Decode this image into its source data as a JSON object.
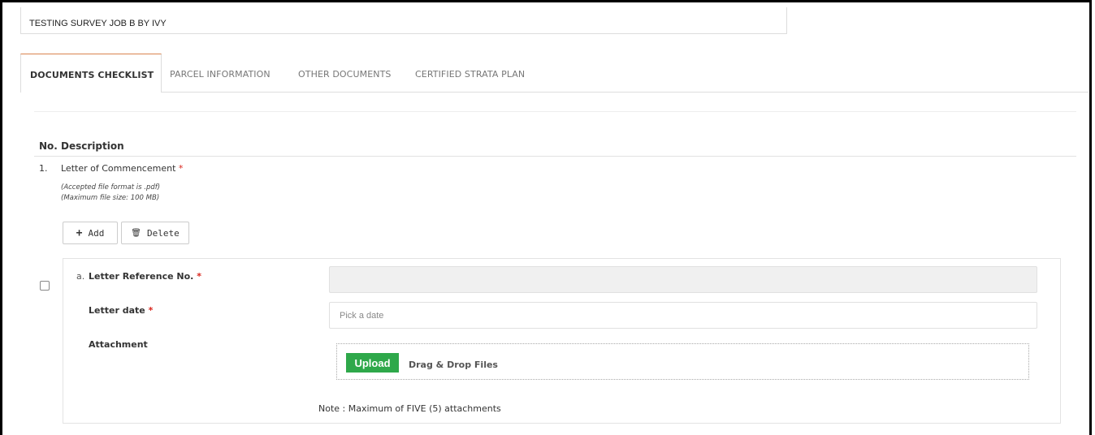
{
  "job": {
    "title": "TESTING SURVEY JOB B BY IVY"
  },
  "tabs": [
    {
      "label": "DOCUMENTS CHECKLIST",
      "active": true
    },
    {
      "label": "PARCEL INFORMATION"
    },
    {
      "label": "OTHER DOCUMENTS"
    },
    {
      "label": "CERTIFIED STRATA PLAN"
    }
  ],
  "table": {
    "col_no": "No.",
    "col_desc": "Description"
  },
  "item": {
    "number": "1.",
    "title": "Letter of Commencement",
    "required_mark": "*",
    "format_note": "(Accepted file format is .pdf)",
    "size_note": "(Maximum file size: 100 MB)"
  },
  "buttons": {
    "add": "Add",
    "delete": "Delete",
    "add_icon": "+",
    "delete_icon": "🗑"
  },
  "entry": {
    "letter": "a.",
    "ref_label": "Letter Reference No.",
    "ref_value": "",
    "date_label": "Letter date",
    "date_placeholder": "Pick a date",
    "attachment_label": "Attachment",
    "upload_label": "Upload",
    "drop_text": "Drag & Drop Files",
    "max_note": "Note : Maximum of FIVE (5) attachments"
  },
  "colors": {
    "upload": "#2ea84a",
    "required": "#d9241b",
    "tab_accent": "#d9834e"
  }
}
